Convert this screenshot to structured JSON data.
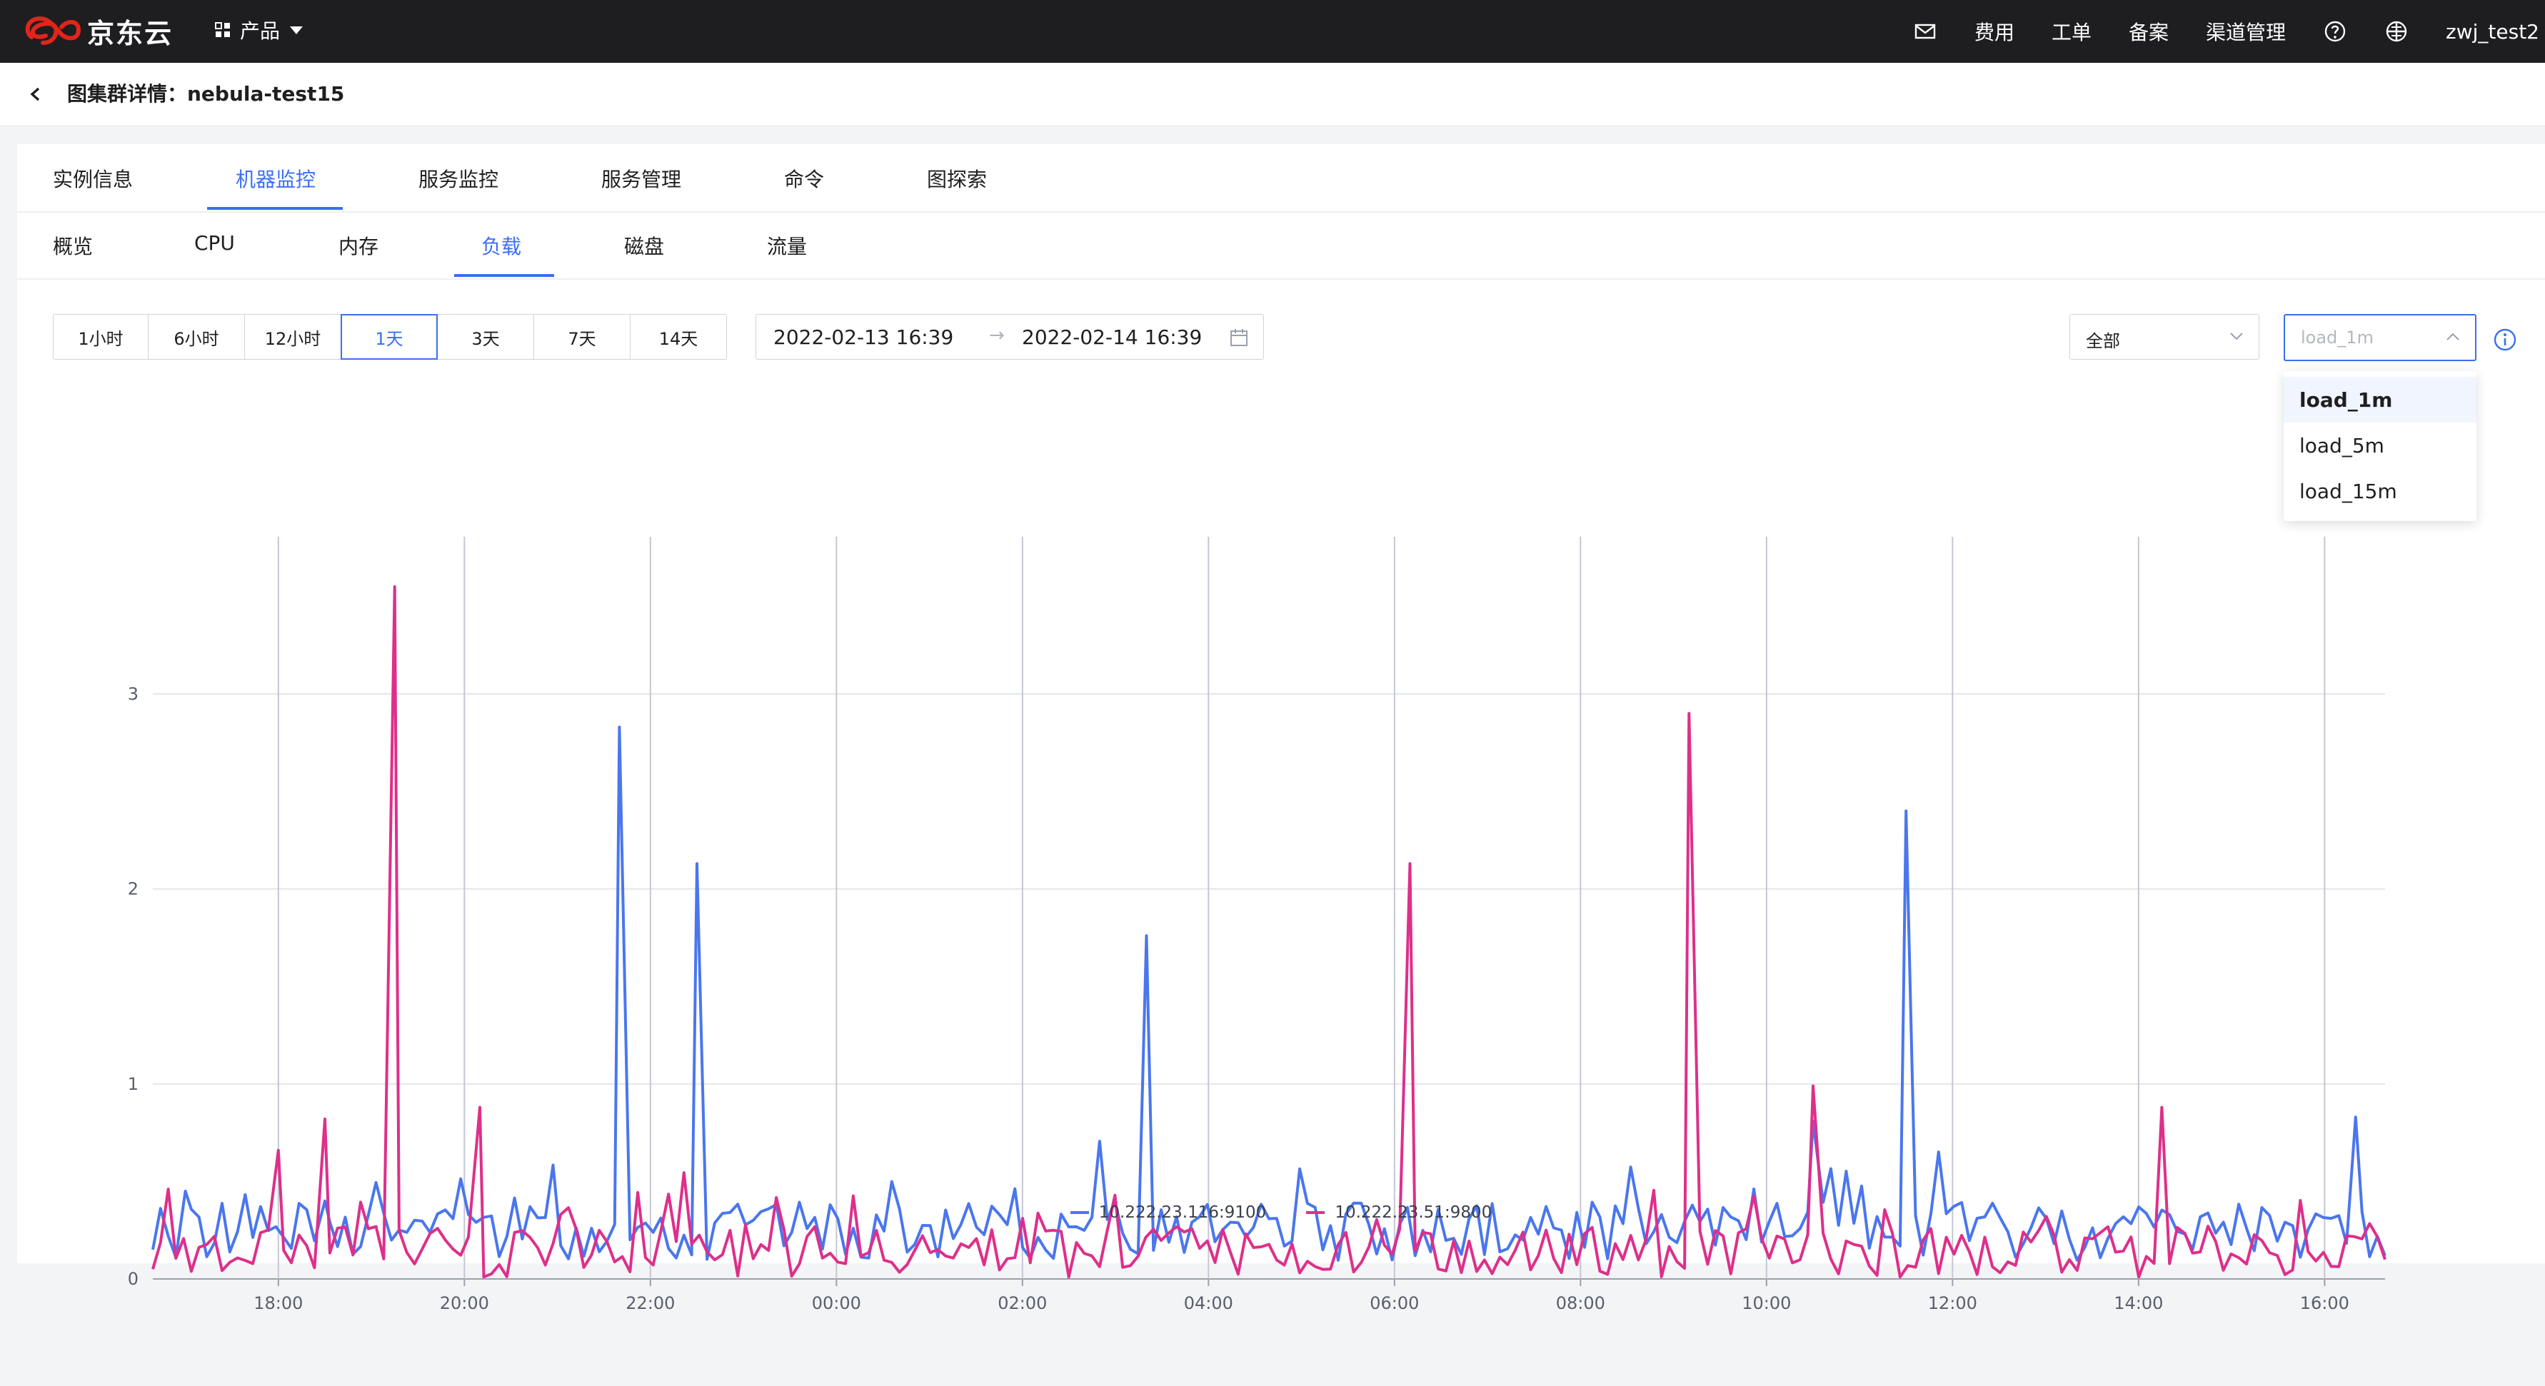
{
  "topbar": {
    "logo_text": "京东云",
    "products_label": "产品",
    "nav": [
      "费用",
      "工单",
      "备案",
      "渠道管理"
    ],
    "icons": [
      "mail-icon",
      "help-icon",
      "globe-icon"
    ],
    "username": "zwj_test2"
  },
  "header": {
    "title": "图集群详情：nebula-test15"
  },
  "tabs": [
    "实例信息",
    "机器监控",
    "服务监控",
    "服务管理",
    "命令",
    "图探索"
  ],
  "active_tab": "机器监控",
  "subtabs": [
    "概览",
    "CPU",
    "内存",
    "负载",
    "磁盘",
    "流量"
  ],
  "active_subtab": "负载",
  "time_ranges": [
    "1小时",
    "6小时",
    "12小时",
    "1天",
    "3天",
    "7天",
    "14天"
  ],
  "active_range": "1天",
  "date_range": {
    "start": "2022-02-13 16:39",
    "arrow": "→",
    "end": "2022-02-14 16:39"
  },
  "host_select": {
    "value": "全部"
  },
  "metric_select": {
    "value": "load_1m",
    "options": [
      "load_1m",
      "load_5m",
      "load_15m"
    ],
    "selected": "load_1m"
  },
  "colors": {
    "accent": "#3a6ff3",
    "series_blue": "#4a76ee",
    "series_pink": "#de2f8a",
    "topbar": "#1e1e21"
  },
  "chart_data": {
    "type": "line",
    "x_range": [
      "2022-02-13 16:39",
      "2022-02-14 16:39"
    ],
    "x_tick_labels": [
      "18:00",
      "20:00",
      "22:00",
      "00:00",
      "02:00",
      "04:00",
      "06:00",
      "08:00",
      "10:00",
      "12:00",
      "14:00",
      "16:00"
    ],
    "y_tick_labels": [
      "0",
      "1",
      "2",
      "3"
    ],
    "ylim": [
      0,
      3.55
    ],
    "series": [
      {
        "name": "10.222.23.116:9100",
        "color": "#4a76ee",
        "baseline": 0.2,
        "points": [
          {
            "time": "2022-02-13 16:39",
            "value": 0.15
          },
          {
            "time": "2022-02-13 17:00",
            "value": 0.45
          },
          {
            "time": "2022-02-13 18:30",
            "value": 0.4
          },
          {
            "time": "2022-02-13 21:40",
            "value": 2.83
          },
          {
            "time": "2022-02-13 22:30",
            "value": 2.13
          },
          {
            "time": "2022-02-14 03:20",
            "value": 1.76
          },
          {
            "time": "2022-02-14 10:30",
            "value": 0.81
          },
          {
            "time": "2022-02-14 11:30",
            "value": 2.4
          },
          {
            "time": "2022-02-14 16:20",
            "value": 0.83
          },
          {
            "time": "2022-02-14 16:39",
            "value": 0.12
          }
        ]
      },
      {
        "name": "10.222.23.51:9800",
        "color": "#de2f8a",
        "baseline": 0.1,
        "points": [
          {
            "time": "2022-02-13 16:39",
            "value": 0.05
          },
          {
            "time": "2022-02-13 18:00",
            "value": 0.66
          },
          {
            "time": "2022-02-13 18:30",
            "value": 0.82
          },
          {
            "time": "2022-02-13 19:15",
            "value": 3.55
          },
          {
            "time": "2022-02-13 20:10",
            "value": 0.88
          },
          {
            "time": "2022-02-14 06:10",
            "value": 2.13
          },
          {
            "time": "2022-02-14 09:10",
            "value": 2.9
          },
          {
            "time": "2022-02-14 10:30",
            "value": 0.99
          },
          {
            "time": "2022-02-14 14:15",
            "value": 0.88
          },
          {
            "time": "2022-02-14 16:39",
            "value": 0.1
          }
        ]
      }
    ],
    "legend_position": "bottom-center",
    "grid": true
  }
}
